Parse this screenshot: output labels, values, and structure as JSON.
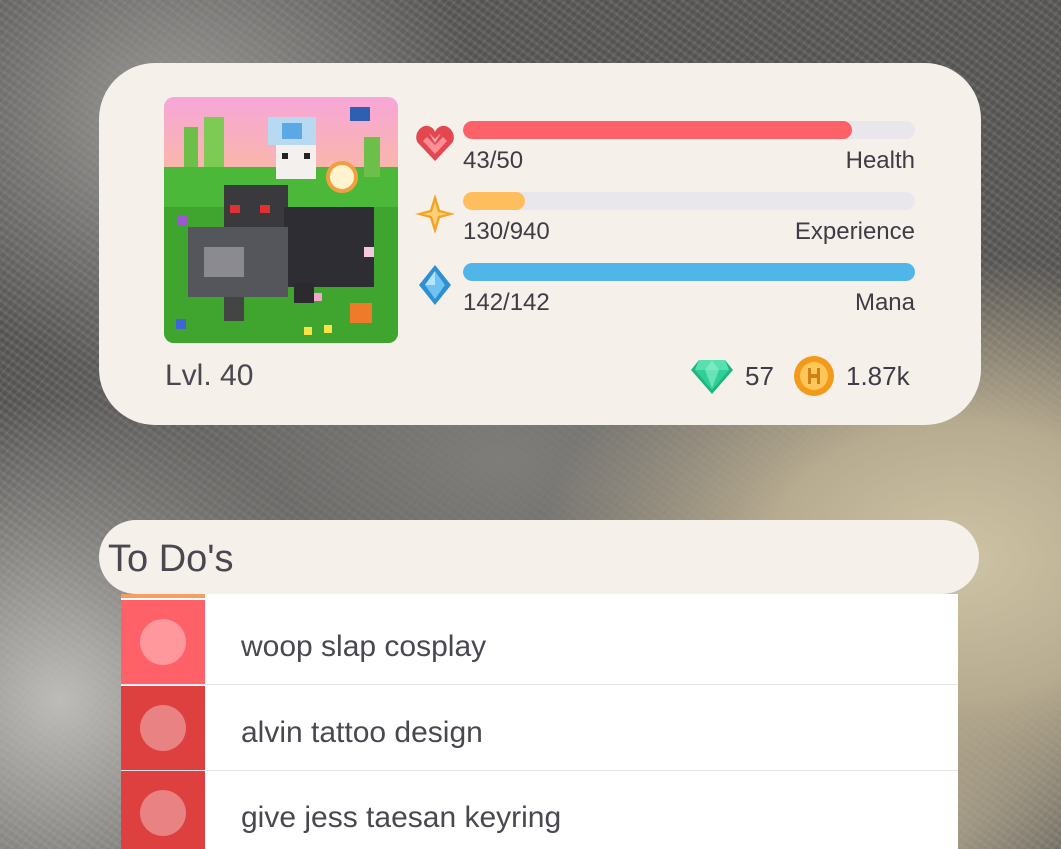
{
  "stats": {
    "level": "Lvl. 40",
    "health": {
      "value": "43/50",
      "label": "Health",
      "fraction": 0.86,
      "color": "#ff6169"
    },
    "experience": {
      "value": "130/940",
      "label": "Experience",
      "fraction": 0.138,
      "color": "#ffbe5d"
    },
    "mana": {
      "value": "142/142",
      "label": "Mana",
      "fraction": 1.0,
      "color": "#50b5e9"
    },
    "gems": {
      "value": "57",
      "icon": "gem-icon",
      "color": "#24cc8f"
    },
    "gold": {
      "value": "1.87k",
      "icon": "gold-coin-icon",
      "color": "#f5a623"
    }
  },
  "todos": {
    "title": "To Do's",
    "items": [
      {
        "text": "woop slap cosplay",
        "color": "#ff6169"
      },
      {
        "text": "alvin tattoo design",
        "color": "#de3f3f"
      },
      {
        "text": "give jess taesan keyring",
        "color": "#de3f3f"
      }
    ]
  }
}
